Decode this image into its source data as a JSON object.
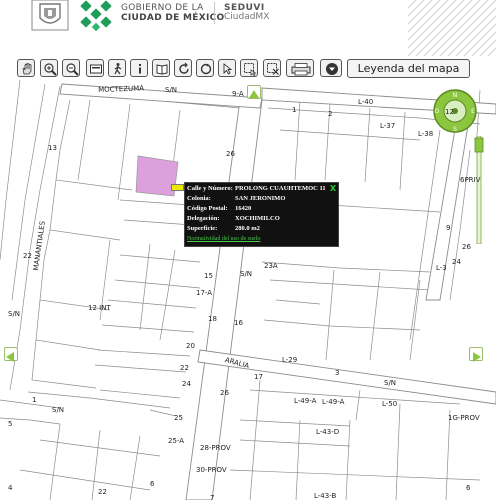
{
  "header": {
    "brand_line1": "GOBIERNO DE LA",
    "brand_line2": "CIUDAD DE MÉXICO",
    "agency_line1": "SEDUVI",
    "agency_line2": "CiudadMX"
  },
  "toolbar": {
    "tools": [
      "pan-hand-icon",
      "zoom-in-icon",
      "zoom-out-icon",
      "full-extent-icon",
      "walk-icon",
      "info-icon",
      "book-icon",
      "refresh-icon",
      "refresh-alt-icon",
      "globe-icon",
      "select-arrow-icon",
      "select-area-icon",
      "clear-selection-icon",
      "print-icon",
      "download-icon"
    ],
    "legend_label": "Leyenda del mapa"
  },
  "colors": {
    "parcel_highlight": "#dca0dc",
    "nav_green": "#8cc63f",
    "popup_bg": "#111111",
    "popup_link": "#44cc44",
    "road_fill": "#ffffff",
    "block_line": "#888888"
  },
  "popup": {
    "close": "X",
    "rows": [
      {
        "key": "Calle y Número:",
        "value": "PROLONG CUAUHTEMOC 11"
      },
      {
        "key": "Colonia:",
        "value": "SAN JERONIMO"
      },
      {
        "key": "Código Postal:",
        "value": "16420"
      },
      {
        "key": "Delegación:",
        "value": "XOCHIMILCO"
      },
      {
        "key": "Superficie:",
        "value": "280.0 m2"
      }
    ],
    "link": "Normatividad del uso de suelo"
  },
  "map": {
    "labels": [
      {
        "text": "MOCTEZUMA"
      },
      {
        "text": "S/N"
      },
      {
        "text": "9-A"
      },
      {
        "text": "L-40"
      },
      {
        "text": "1"
      },
      {
        "text": "2"
      },
      {
        "text": "12"
      },
      {
        "text": "L-37"
      },
      {
        "text": "L-38"
      },
      {
        "text": "13"
      },
      {
        "text": "26"
      },
      {
        "text": "6PRIV"
      },
      {
        "text": "MANANTIALES"
      },
      {
        "text": "9"
      },
      {
        "text": "26"
      },
      {
        "text": "24"
      },
      {
        "text": "L-3"
      },
      {
        "text": "22"
      },
      {
        "text": "15"
      },
      {
        "text": "23A"
      },
      {
        "text": "S/N"
      },
      {
        "text": "17-A"
      },
      {
        "text": "12 INT"
      },
      {
        "text": "S/N"
      },
      {
        "text": "18"
      },
      {
        "text": "16"
      },
      {
        "text": "20"
      },
      {
        "text": "ARALIA"
      },
      {
        "text": "L-29"
      },
      {
        "text": "22"
      },
      {
        "text": "24"
      },
      {
        "text": "17"
      },
      {
        "text": "3"
      },
      {
        "text": "S/N"
      },
      {
        "text": "1"
      },
      {
        "text": "S/N"
      },
      {
        "text": "26"
      },
      {
        "text": "L-49-A"
      },
      {
        "text": "L-49-A"
      },
      {
        "text": "L-50"
      },
      {
        "text": "1G-PROV"
      },
      {
        "text": "25"
      },
      {
        "text": "L-43-D"
      },
      {
        "text": "25-A"
      },
      {
        "text": "28-PROV"
      },
      {
        "text": "5"
      },
      {
        "text": "30-PROV"
      },
      {
        "text": "L-43-B"
      },
      {
        "text": "6"
      },
      {
        "text": "4"
      },
      {
        "text": "22"
      },
      {
        "text": "6"
      },
      {
        "text": "7"
      }
    ]
  }
}
